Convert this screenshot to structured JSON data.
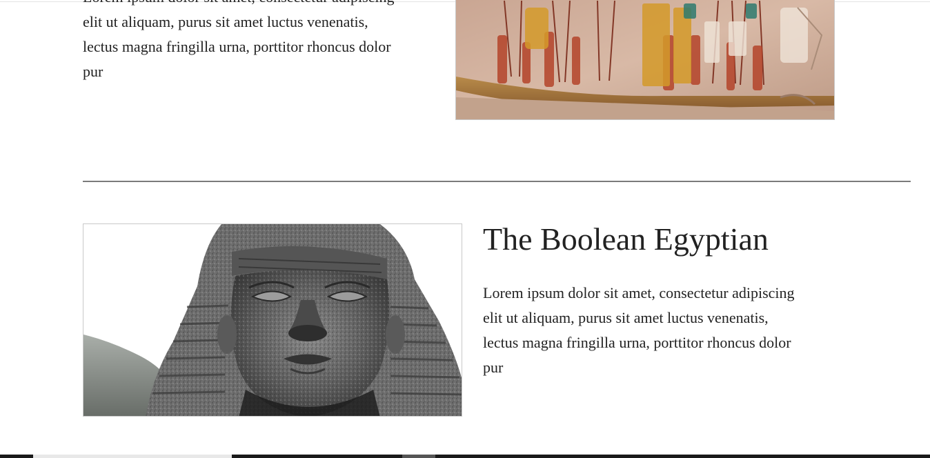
{
  "top_article": {
    "body_lines": [
      "Lorem ipsum dolor sit amet, consectetur adipiscing",
      "elit ut aliquam, purus sit amet luctus venenatis,",
      "lectus magna fringilla urna, porttitor rhoncus dolor",
      "pur"
    ],
    "image_icon": "egyptian-relief-image"
  },
  "article": {
    "title": "The Boolean Egyptian",
    "body_lines": [
      "Lorem ipsum dolor sit amet, consectetur adipiscing",
      "elit ut aliquam, purus sit amet luctus venenatis,",
      "lectus magna fringilla urna, porttitor rhoncus dolor",
      "pur"
    ],
    "image_icon": "pharaoh-statue-image"
  },
  "colors": {
    "text": "#222222",
    "divider": "#7a7a7a",
    "image_border": "#c8c8c8",
    "bottom_bar": "#1a1a1a"
  }
}
